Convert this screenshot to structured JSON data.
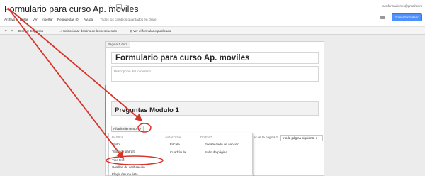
{
  "window": {
    "title": "Formulario para curso Ap. moviles",
    "account": "aenformaciones@gmail.com",
    "send_button": "Enviar formulario"
  },
  "menubar": {
    "items": [
      "Archivo",
      "Editar",
      "Ver",
      "Insertar",
      "Respuestas (0)",
      "Ayuda"
    ],
    "saved_status": "Todos los cambios guardados en Drive"
  },
  "toolbar": {
    "undo_icon": "undo-icon",
    "redo_icon": "redo-icon",
    "theme": "Diseño: Espresso",
    "destination": "Seleccionar destino de las respuestas",
    "view_published": "Ver el formulario publicado"
  },
  "form": {
    "page_label": "Página 1 de 2",
    "title": "Formulario para curso Ap. moviles",
    "description_placeholder": "Descripción del formulario",
    "section_title": "Preguntas Modulo 1",
    "add_item_button": "Añadir elemento",
    "page_label_bottom": "Pá",
    "after_page_text": "es de la página 1",
    "goto_page_select": "Ir a la página siguiente"
  },
  "add_menu": {
    "headers": [
      "Básica",
      "Avanzada",
      "Diseño"
    ],
    "basic": [
      "Texto",
      "Texto de párrafo",
      "Tipo test",
      "Casillas de verificación",
      "Elegir de una lista"
    ],
    "advanced": [
      "Escala",
      "Cuadrícula"
    ],
    "layout": [
      "Encabezado de sección",
      "Salto de página"
    ]
  },
  "annotations": {
    "arrow_color": "#d7332a",
    "highlight_color": "#d7332a"
  }
}
